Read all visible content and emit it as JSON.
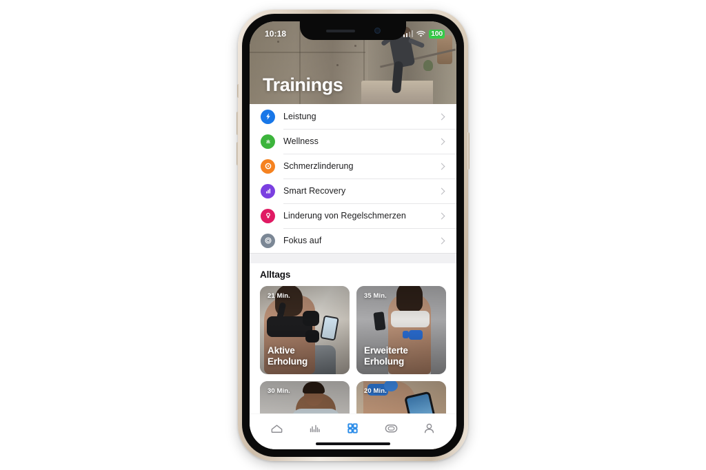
{
  "device": {
    "status_bar": {
      "time": "10:18",
      "battery": "100",
      "signal_icon": "cellular-signal-icon",
      "wifi_icon": "wifi-icon"
    }
  },
  "header": {
    "title": "Trainings"
  },
  "program_list": {
    "items": [
      {
        "label": "Leistung",
        "icon": "lightning-bolt-icon",
        "color": "#1877e8"
      },
      {
        "label": "Wellness",
        "icon": "lotus-icon",
        "color": "#3cb43c"
      },
      {
        "label": "Schmerzlinderung",
        "icon": "target-ring-icon",
        "color": "#f58220"
      },
      {
        "label": "Smart Recovery",
        "icon": "bar-chart-icon",
        "color": "#7a3fe0"
      },
      {
        "label": "Linderung von Regelschmerzen",
        "icon": "venus-symbol-icon",
        "color": "#e01a63"
      },
      {
        "label": "Fokus auf",
        "icon": "concentric-circles-icon",
        "color": "#7b8795"
      }
    ],
    "chevron_icon": "chevron-right-icon"
  },
  "everyday_section": {
    "title": "Alltags",
    "cards": [
      {
        "duration": "21 Min.",
        "title_line1": "Aktive",
        "title_line2": "Erholung"
      },
      {
        "duration": "35 Min.",
        "title_line1": "Erweiterte",
        "title_line2": "Erholung"
      },
      {
        "duration": "30 Min.",
        "title_line1": "",
        "title_line2": ""
      },
      {
        "duration": "20 Min.",
        "title_line1": "",
        "title_line2": ""
      }
    ]
  },
  "tab_bar": {
    "active_color": "#2b8ce8",
    "inactive_color": "#8e8e93",
    "tabs": [
      {
        "name": "home",
        "icon": "home-icon",
        "active": false
      },
      {
        "name": "stats",
        "icon": "bar-chart-icon",
        "active": false
      },
      {
        "name": "trainings",
        "icon": "grid-icon",
        "active": true
      },
      {
        "name": "device",
        "icon": "device-oval-icon",
        "active": false
      },
      {
        "name": "profile",
        "icon": "person-icon",
        "active": false
      }
    ]
  }
}
